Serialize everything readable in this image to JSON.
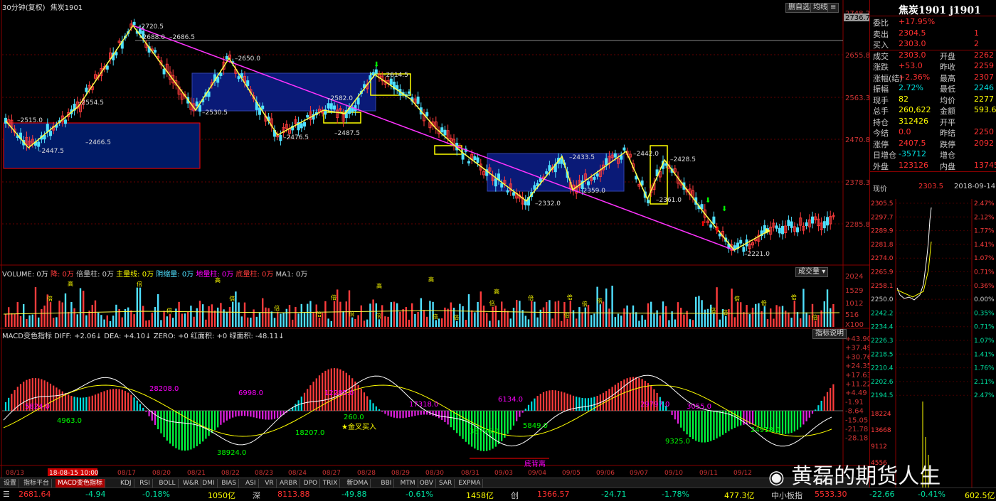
{
  "header": {
    "period": "30分钟(复权)",
    "symbol": "焦炭1901",
    "btn_restore": "删自选",
    "btn_avg": "均线",
    "btn_extra": "≡"
  },
  "main_chart": {
    "price_ticks": [
      "2748.2",
      "2736.7",
      "2655.8",
      "2563.3",
      "2470.8",
      "2378.3",
      "2285.8"
    ],
    "wave_labels": [
      "2720.5",
      "2688.0",
      "2686.5",
      "2650.0",
      "2614.5",
      "2582.0",
      "2554.5",
      "2515.0",
      "2530.5",
      "2476.5",
      "2487.5",
      "2447.5",
      "2466.5",
      "2442.0",
      "2433.5",
      "2428.5",
      "2359.0",
      "2361.0",
      "2332.0",
      "2221.0"
    ]
  },
  "volume_panel": {
    "legend_prefix": "VOLUME: 0万",
    "legend_items": [
      "降: 0万",
      "倍量柱: 0万",
      "主量线: 0万",
      "阴缩量: 0万",
      "地量柱: 0万",
      "底量柱: 0万",
      "MA1: 0万"
    ],
    "dropdown": "成交量",
    "ticks": [
      "2024",
      "1529",
      "1012",
      "516",
      "X100"
    ],
    "marker_gao": "高",
    "marker_bei": "倍"
  },
  "macd_panel": {
    "legend": "MACD变色指标 DIFF: +2.06↓ DEA: +4.10↓ ZERO: +0 红面积: +0 绿面积: -48.11↓",
    "help_btn": "指标说明",
    "ticks": [
      "+43.90",
      "+37.49",
      "+30.76",
      "+24.35",
      "+17.63",
      "+11.22",
      "+4.49",
      "-1.91",
      "-8.64",
      "-15.05",
      "-21.78",
      "-28.18"
    ],
    "area_labels": [
      "5824.0",
      "4963.0",
      "28208.0",
      "38924.0",
      "6998.0",
      "18207.0",
      "12285.0",
      "260.0",
      "17318.0",
      "33776.0",
      "6134.0",
      "5849.0",
      "29797.0",
      "9325.0",
      "3055.0",
      "24918.0"
    ],
    "signal": "★金叉买入",
    "divergence": "底背离"
  },
  "dates": [
    "08/13",
    "18-08-15 10:00",
    "08/17",
    "08/20",
    "08/21",
    "08/22",
    "08/23",
    "08/24",
    "08/27",
    "08/28",
    "08/29",
    "08/30",
    "08/31",
    "09/03",
    "09/04",
    "09/05",
    "09/06",
    "09/07",
    "09/10",
    "09/11",
    "09/12"
  ],
  "tabs": [
    "设置",
    "指标平台",
    "MACD变色指标",
    "KDJ",
    "RSI",
    "BOLL",
    "W&R",
    "DMI",
    "BIAS",
    "ASI",
    "VR",
    "ARBR",
    "DPO",
    "TRIX",
    "新DMA",
    "BBI",
    "MTM",
    "OBV",
    "SAR",
    "EXPMA"
  ],
  "status_bar": {
    "index1_value": "2681.64",
    "index1_change": "-4.94",
    "index1_pct": "-0.18%",
    "index1_amount": "1050亿",
    "shen_label": "深",
    "shen_value": "8113.88",
    "shen_change": "-49.88",
    "shen_pct": "-0.61%",
    "shen_amount": "1458亿",
    "chuang_label": "创",
    "chuang_value": "1366.57",
    "chuang_change": "-24.71",
    "chuang_pct": "-1.78%",
    "chuang_amount": "477.3亿",
    "zxb_label": "中小板指",
    "zxb_value": "5533.30",
    "zxb_change": "-22.66",
    "zxb_pct": "-0.41%",
    "zxb_amount": "602.5亿"
  },
  "quote_panel": {
    "title": "焦炭1901 j1901",
    "rows": [
      {
        "l1": "委比",
        "v1": "+17.95%",
        "l2": "",
        "v2": "",
        "c1": "#ff3030"
      },
      {
        "l1": "卖出",
        "v1": "2304.5",
        "l2": "",
        "v2": "1",
        "c1": "#ff3030"
      },
      {
        "l1": "买入",
        "v1": "2303.0",
        "l2": "",
        "v2": "2",
        "c1": "#ff3030"
      },
      {
        "l1": "成交",
        "v1": "2303.0",
        "l2": "开盘",
        "v2": "2262",
        "c1": "#ff3030"
      },
      {
        "l1": "涨跌",
        "v1": "+53.0",
        "l2": "昨收",
        "v2": "2259",
        "c1": "#ff3030"
      },
      {
        "l1": "涨幅(结)",
        "v1": "+2.36%",
        "l2": "最高",
        "v2": "2307",
        "c1": "#ff3030"
      },
      {
        "l1": "振幅",
        "v1": "2.72%",
        "l2": "最低",
        "v2": "2246",
        "c1": "#00e0e0"
      },
      {
        "l1": "现手",
        "v1": "82",
        "l2": "均价",
        "v2": "2277",
        "c1": "#ffff00"
      },
      {
        "l1": "总手",
        "v1": "260,622",
        "l2": "金额",
        "v2": "593.6",
        "c1": "#ffff00"
      },
      {
        "l1": "持仓",
        "v1": "312426",
        "l2": "开平",
        "v2": "",
        "c1": "#ffff00"
      },
      {
        "l1": "今结",
        "v1": "0.0",
        "l2": "昨结",
        "v2": "2250",
        "c1": "#ff3030"
      },
      {
        "l1": "涨停",
        "v1": "2407.5",
        "l2": "跌停",
        "v2": "2092",
        "c1": "#ff3030"
      },
      {
        "l1": "日增仓",
        "v1": "-35712",
        "l2": "增仓",
        "v2": "",
        "c1": "#00e0e0"
      },
      {
        "l1": "外盘",
        "v1": "123126",
        "l2": "内盘",
        "v2": "13745",
        "c1": "#ff3030"
      }
    ],
    "current_label": "现价",
    "current_value": "2303.5",
    "date": "2018-09-14",
    "mini_left_ticks": [
      "2305.5",
      "2297.7",
      "2289.9",
      "2281.8",
      "2274.0",
      "2265.9",
      "2258.1",
      "2250.0",
      "2242.2",
      "2234.4",
      "2226.3",
      "2218.5",
      "2210.4",
      "2202.6",
      "2194.5"
    ],
    "mini_right_ticks": [
      "2.47%",
      "2.12%",
      "1.77%",
      "1.41%",
      "1.07%",
      "0.71%",
      "0.36%",
      "0.00%",
      "0.35%",
      "0.71%",
      "1.07%",
      "1.41%",
      "1.76%",
      "2.11%",
      "2.47%"
    ],
    "vol_ticks": [
      "18224",
      "13668",
      "9112",
      "4556"
    ]
  },
  "watermark": "黄磊的期货人生"
}
